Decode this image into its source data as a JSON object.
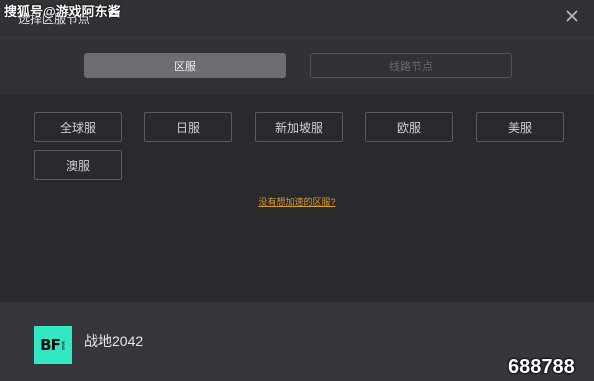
{
  "watermark_top": "搜狐号@游戏阿东酱",
  "dialog": {
    "title": "选择区服节点"
  },
  "tabs": [
    {
      "label": "区服",
      "active": true
    },
    {
      "label": "线路节点",
      "active": false
    }
  ],
  "servers": [
    "全球服",
    "日服",
    "新加坡服",
    "欧服",
    "美服",
    "澳服"
  ],
  "help_link": "没有想加速的区服?",
  "game": {
    "logo_text": "BF",
    "logo_subtext": "2042",
    "name": "战地2042"
  },
  "watermark_bottom": "688788",
  "colors": {
    "accent_link": "#d99a28",
    "logo_bg": "#31e7c4",
    "active_tab": "#6e6e72"
  },
  "icons": {
    "close": "close-icon"
  }
}
